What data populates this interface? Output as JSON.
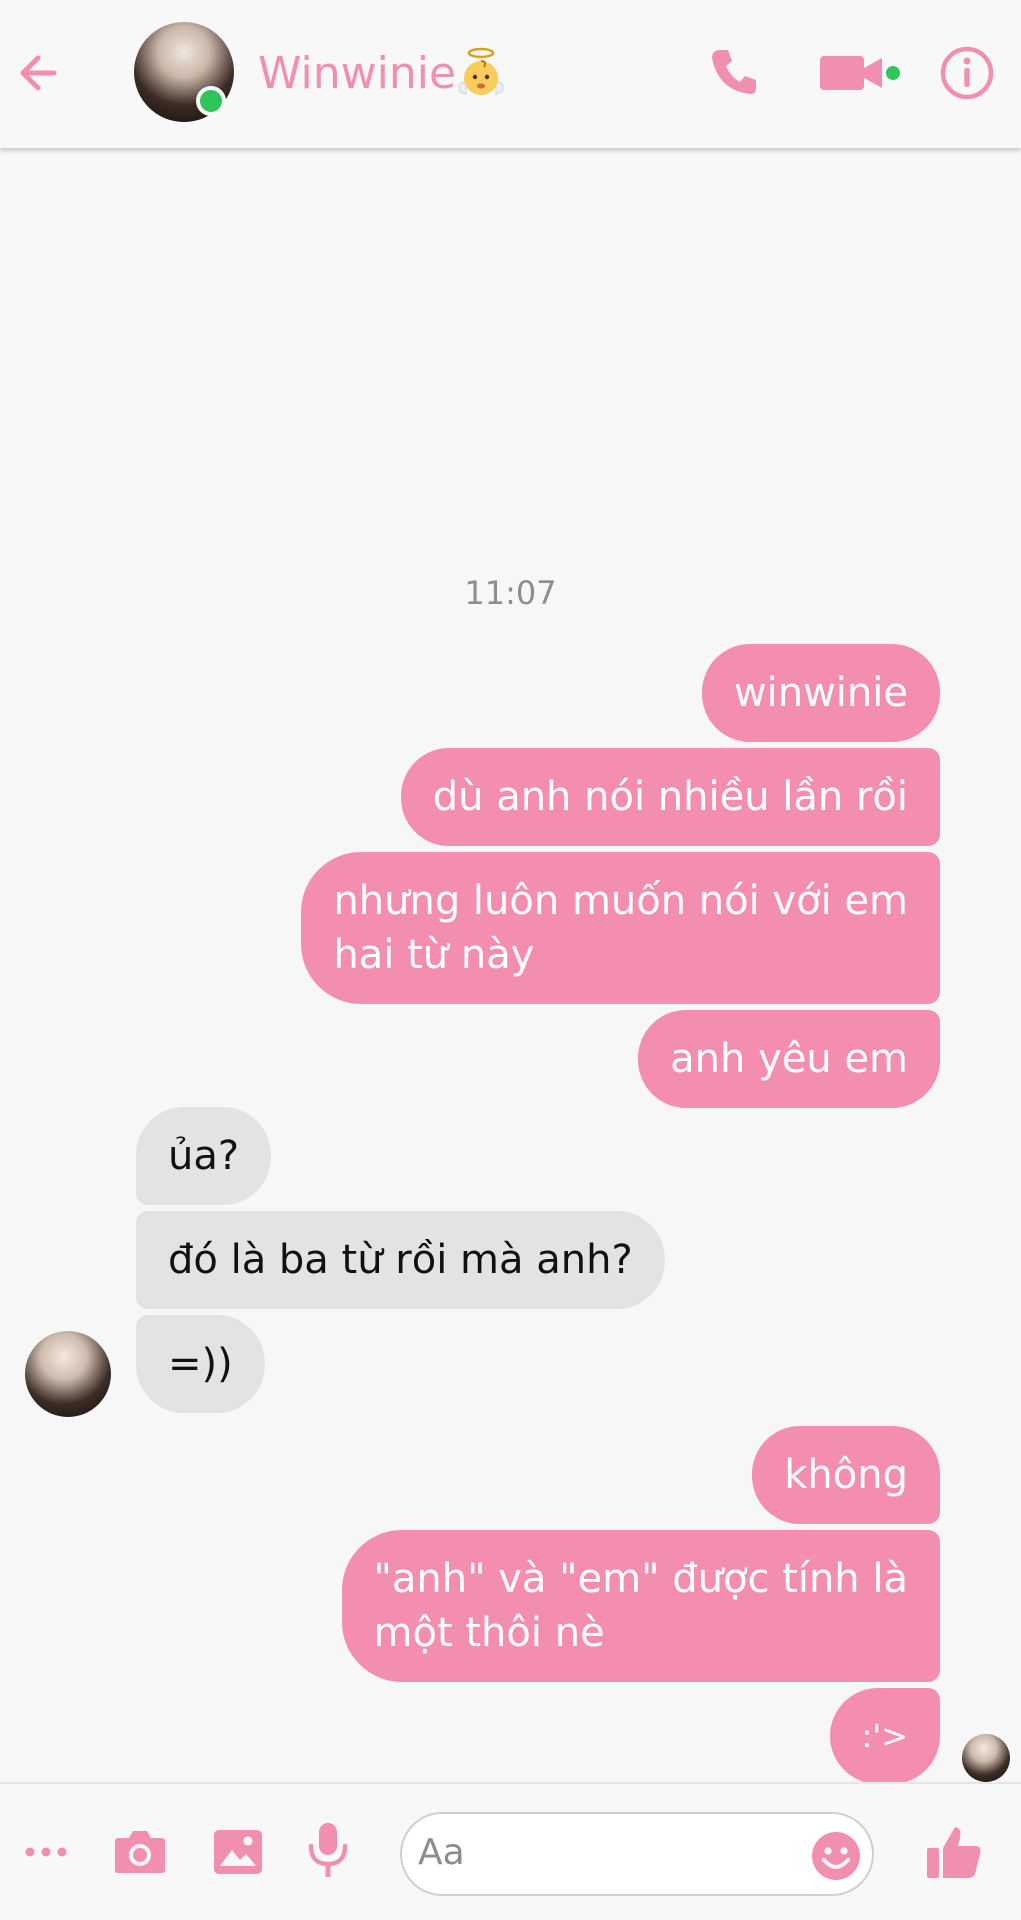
{
  "colors": {
    "accent": "#f18fb0",
    "outgoing_bubble": "#f38eb0",
    "incoming_bubble": "#e3e3e3",
    "online": "#2ec55a"
  },
  "header": {
    "contact_name": "Winwinie",
    "icons": [
      "back-arrow-icon",
      "angel-emoji-icon",
      "phone-icon",
      "video-camera-icon",
      "info-icon"
    ]
  },
  "chat": {
    "timestamp": "11:07",
    "messages": [
      {
        "dir": "out",
        "line1": "winwinie"
      },
      {
        "dir": "out",
        "line1": "dù anh nói nhiều lần rồi"
      },
      {
        "dir": "out",
        "line1": "nhưng luôn muốn nói với em",
        "line2": "hai từ này"
      },
      {
        "dir": "out",
        "line1": "anh yêu em"
      },
      {
        "dir": "in",
        "line1": "ủa?"
      },
      {
        "dir": "in",
        "line1": "đó là ba từ rồi mà anh?"
      },
      {
        "dir": "in",
        "line1": "=))"
      },
      {
        "dir": "out",
        "line1": "không"
      },
      {
        "dir": "out",
        "line1": "\"anh\" và \"em\" được tính là",
        "line2": "một thôi nè"
      },
      {
        "dir": "out",
        "line1": ":'>"
      }
    ]
  },
  "composer": {
    "placeholder": "Aa",
    "icons": [
      "more-dots-icon",
      "camera-icon",
      "image-icon",
      "microphone-icon",
      "emoji-icon",
      "thumbs-up-icon"
    ]
  }
}
